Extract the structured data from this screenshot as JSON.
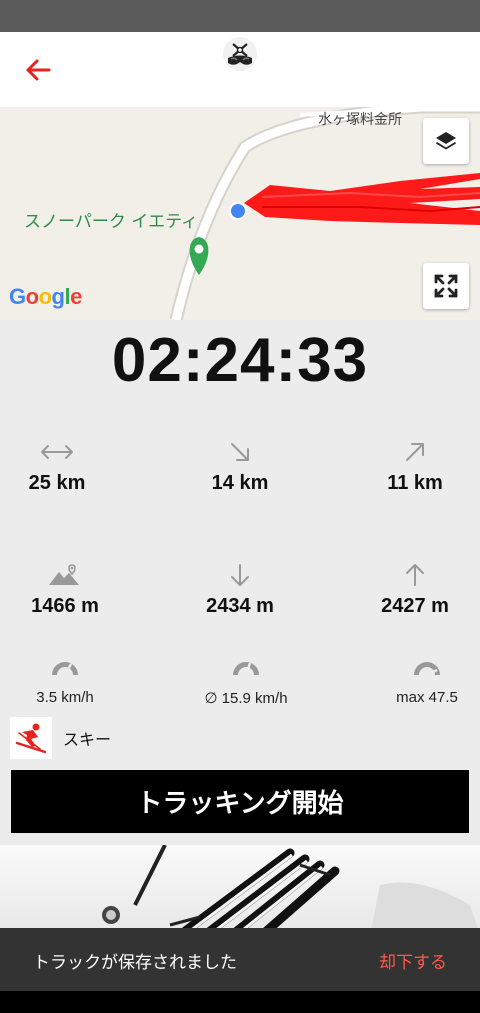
{
  "header": {
    "back_icon": "arrow-left-icon",
    "logo_icon": "ski-logo-icon",
    "accent_color": "#e8231e"
  },
  "map": {
    "toll_label": "水ヶ塚料金所",
    "park_label": "スノーパーク イエティ",
    "google_label": [
      "G",
      "o",
      "o",
      "g",
      "l",
      "e"
    ],
    "layers_icon": "layers-icon",
    "fullscreen_icon": "expand-icon"
  },
  "timer": "02:24:33",
  "stats": {
    "distance": {
      "icon": "horizontal-arrows-icon",
      "value": "25 km"
    },
    "downhill_distance": {
      "icon": "arrow-down-right-icon",
      "value": "14 km"
    },
    "uphill_distance": {
      "icon": "arrow-up-right-icon",
      "value": "11 km"
    },
    "altitude": {
      "icon": "mountain-pin-icon",
      "value": "1466 m"
    },
    "descent": {
      "icon": "arrow-down-icon",
      "value": "2434 m"
    },
    "ascent": {
      "icon": "arrow-up-icon",
      "value": "2427 m"
    },
    "speed": {
      "icon": "speedometer-icon",
      "value": "3.5 km/h"
    },
    "avg_speed": {
      "icon": "speedometer-icon",
      "value": "∅ 15.9 km/h"
    },
    "max_speed": {
      "icon": "speedometer-max-icon",
      "value": "max 47.5"
    }
  },
  "sport": {
    "icon": "skier-icon",
    "label": "スキー"
  },
  "start_button": "トラッキング開始",
  "snackbar": {
    "message": "トラックが保存されました",
    "action": "却下する"
  }
}
